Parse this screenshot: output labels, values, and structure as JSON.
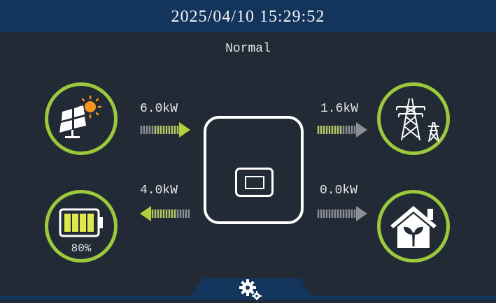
{
  "header": {
    "datetime": "2025/04/10  15:29:52"
  },
  "status": "Normal",
  "flows": {
    "pv_power": "6.0kW",
    "grid_power": "1.6kW",
    "battery_power": "4.0kW",
    "load_power": "0.0kW"
  },
  "battery": {
    "soc_label": "80%",
    "soc_fraction": 0.8
  },
  "icons": {
    "pv": "solar-panel-icon",
    "grid": "power-tower-icon",
    "battery": "battery-icon",
    "load": "house-icon",
    "inverter": "inverter-icon",
    "settings": "gear-icon"
  },
  "colors": {
    "accent": "#9bc93b",
    "header": "#13355c",
    "background": "#222a35",
    "sun": "#f7941d"
  }
}
